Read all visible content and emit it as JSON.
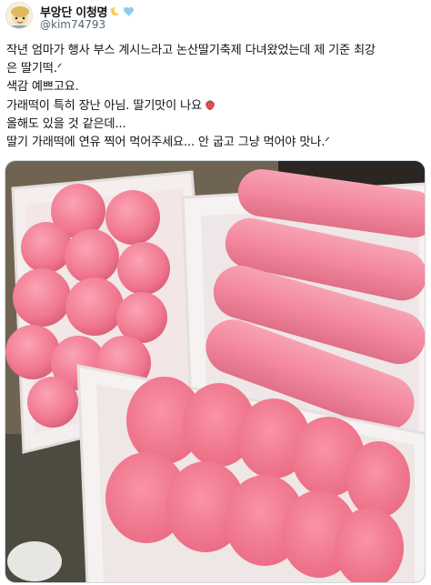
{
  "user": {
    "display_name": "부앙단 이청명",
    "handle": "@kim74793",
    "name_emojis": [
      "sparkle-moon-icon",
      "blue-heart-icon"
    ]
  },
  "tweet": {
    "lines": [
      "작년 엄마가 행사 부스 계시느라고 논산딸기축제 다녀왔었는데 제 기준 최강",
      "은 딸기떡.ᐟ",
      "색감 예쁘고요.",
      "가래떡이 특히 장난 아님. 딸기맛이 나요",
      "올해도 있을 것 같은데...",
      "딸기 가래떡에 연유 찍어 먹어주세요... 안 굽고 그냥 먹어야 맛나.ᐟ"
    ],
    "inline_icon": "strawberry-icon"
  },
  "media": {
    "type": "photo",
    "description_icon": "strawberry-rice-cake-photo"
  },
  "colors": {
    "text": "#0f1419",
    "secondary_text": "#536471",
    "rice_cake_pink": "#f48aa0",
    "tray_white": "#f7f3f2",
    "heart_blue": "#8ecdf3"
  }
}
